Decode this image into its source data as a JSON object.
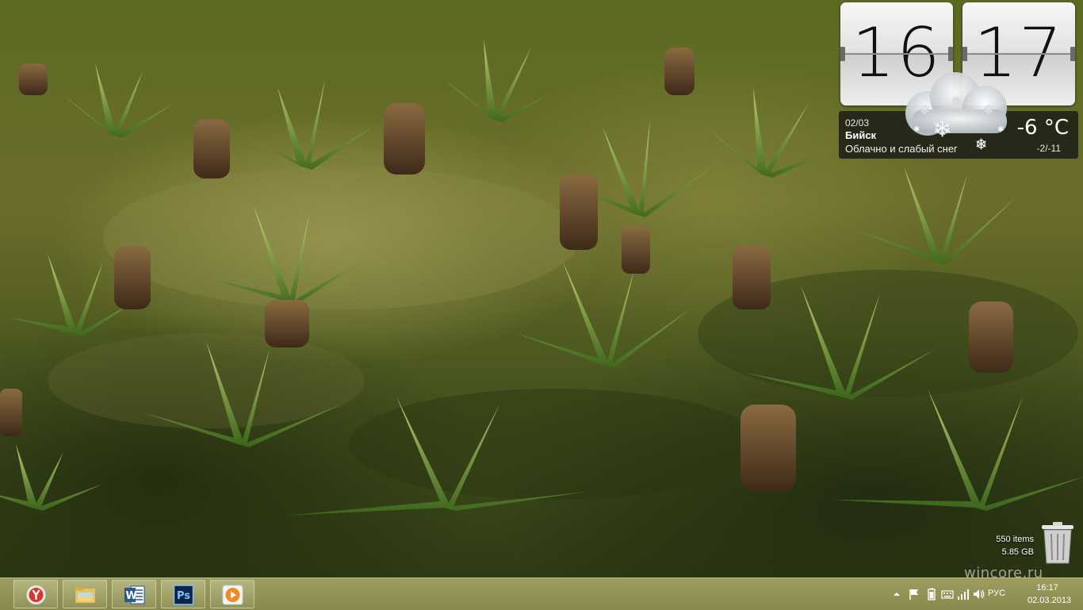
{
  "widgets": {
    "clock": {
      "hours": "16",
      "minutes": "17"
    },
    "weather": {
      "date": "02/03",
      "city": "Бийск",
      "description": "Облачно и слабый снег",
      "temperature": "-6 °C",
      "range": "-2/-11",
      "icon": "snow-cloud-icon"
    }
  },
  "desktop": {
    "recycle_bin": {
      "items": "550 items",
      "size": "5.85 GB",
      "icon": "recycle-bin-icon"
    }
  },
  "taskbar": {
    "pinned": [
      {
        "name": "yandex-browser",
        "icon": "yandex-browser-icon"
      },
      {
        "name": "file-explorer",
        "icon": "file-explorer-icon"
      },
      {
        "name": "word",
        "icon": "word-icon"
      },
      {
        "name": "photoshop",
        "icon": "photoshop-icon",
        "label": "Ps"
      },
      {
        "name": "media-player",
        "icon": "media-player-icon"
      }
    ],
    "tray": {
      "icons": [
        "show-hidden-icons-icon",
        "action-center-flag-icon",
        "battery-icon",
        "keyboard-icon",
        "network-signal-icon",
        "volume-icon"
      ],
      "language": "РУС",
      "time": "16:17",
      "date": "02.03.2013"
    }
  },
  "watermark": "wincore.ru",
  "colors": {
    "taskbar": "#9c9c5e",
    "accent": "#f0f0e0"
  }
}
